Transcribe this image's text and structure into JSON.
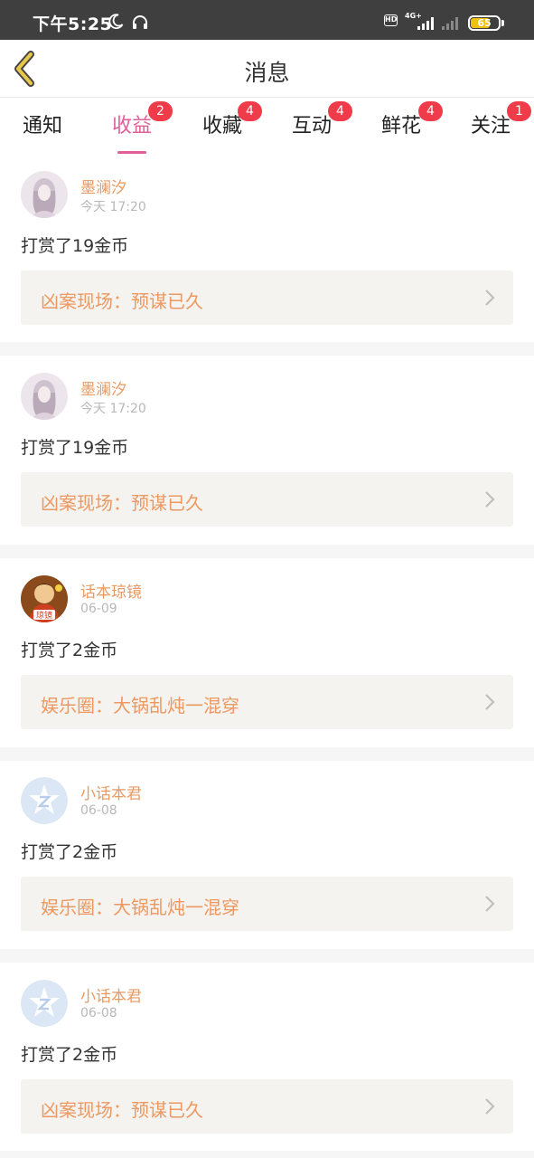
{
  "status_bar": {
    "time": "下午5:25",
    "hd_label": "HD",
    "network_label": "4G+",
    "battery_level": "65"
  },
  "header": {
    "title": "消息"
  },
  "tabs": [
    {
      "label": "通知",
      "badge": ""
    },
    {
      "label": "收益",
      "badge": "2",
      "active": true
    },
    {
      "label": "收藏",
      "badge": "4"
    },
    {
      "label": "互动",
      "badge": "4"
    },
    {
      "label": "鲜花",
      "badge": "4"
    },
    {
      "label": "关注",
      "badge": "1"
    }
  ],
  "messages": [
    {
      "user": "墨澜汐",
      "time": "今天 17:20",
      "text": "打赏了19金币",
      "link": "凶案现场：预谋已久",
      "avatar": "girl-photo"
    },
    {
      "user": "墨澜汐",
      "time": "今天 17:20",
      "text": "打赏了19金币",
      "link": "凶案现场：预谋已久",
      "avatar": "girl-photo"
    },
    {
      "user": "话本琼镜",
      "time": "06-09",
      "text": "打赏了2金币",
      "link": "娱乐圈：大锅乱炖一混穿",
      "avatar": "illustration",
      "avatar_label": "琼镜"
    },
    {
      "user": "小话本君",
      "time": "06-08",
      "text": "打赏了2金币",
      "link": "娱乐圈：大锅乱炖一混穿",
      "avatar": "default-z"
    },
    {
      "user": "小话本君",
      "time": "06-08",
      "text": "打赏了2金币",
      "link": "凶案现场：预谋已久",
      "avatar": "default-z"
    }
  ],
  "colors": {
    "accent": "#e0609a",
    "name": "#e89a62",
    "badge": "#f03c4a",
    "link_bg": "#f4f3ef",
    "back_arrow": "#e8c84a"
  }
}
